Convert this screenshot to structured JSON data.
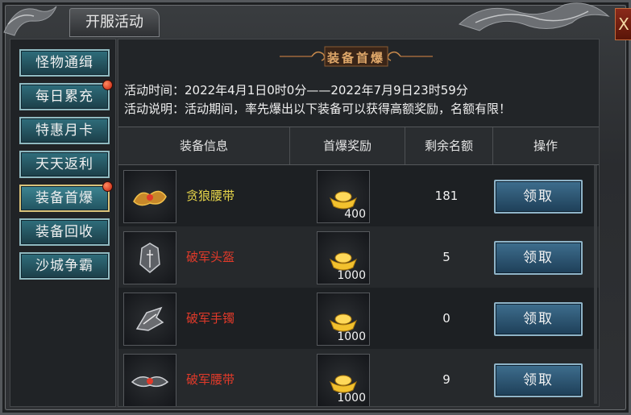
{
  "window": {
    "title": "开服活动",
    "close_label": "X"
  },
  "sidebar": {
    "items": [
      {
        "label": "怪物通缉",
        "badge": false,
        "active": false
      },
      {
        "label": "每日累充",
        "badge": true,
        "active": false
      },
      {
        "label": "特惠月卡",
        "badge": false,
        "active": false
      },
      {
        "label": "天天返利",
        "badge": false,
        "active": false
      },
      {
        "label": "装备首爆",
        "badge": true,
        "active": true
      },
      {
        "label": "装备回收",
        "badge": false,
        "active": false
      },
      {
        "label": "沙城争霸",
        "badge": false,
        "active": false
      }
    ]
  },
  "main": {
    "banner_title": "装备首爆",
    "time_line": "活动时间：2022年4月1日0时0分——2022年7月9日23时59分",
    "desc_line": "活动说明：活动期间，率先爆出以下装备可以获得高额奖励，名额有限！",
    "headers": [
      "装备信息",
      "首爆奖励",
      "剩余名额",
      "操作"
    ],
    "rows": [
      {
        "name": "贪狼腰带",
        "name_color": "#e8d64a",
        "icon": "belt-gold-icon",
        "reward": "400",
        "remaining": "181",
        "action": "领取"
      },
      {
        "name": "破军头盔",
        "name_color": "#e23a2a",
        "icon": "helmet-icon",
        "reward": "1000",
        "remaining": "5",
        "action": "领取"
      },
      {
        "name": "破军手镯",
        "name_color": "#e23a2a",
        "icon": "bracelet-icon",
        "reward": "1000",
        "remaining": "0",
        "action": "领取"
      },
      {
        "name": "破军腰带",
        "name_color": "#e23a2a",
        "icon": "belt-icon",
        "reward": "1000",
        "remaining": "9",
        "action": "领取"
      }
    ]
  },
  "colors": {
    "accent": "#e0a86a",
    "button": "#2f6e7c",
    "gold": "#f2c12e"
  }
}
